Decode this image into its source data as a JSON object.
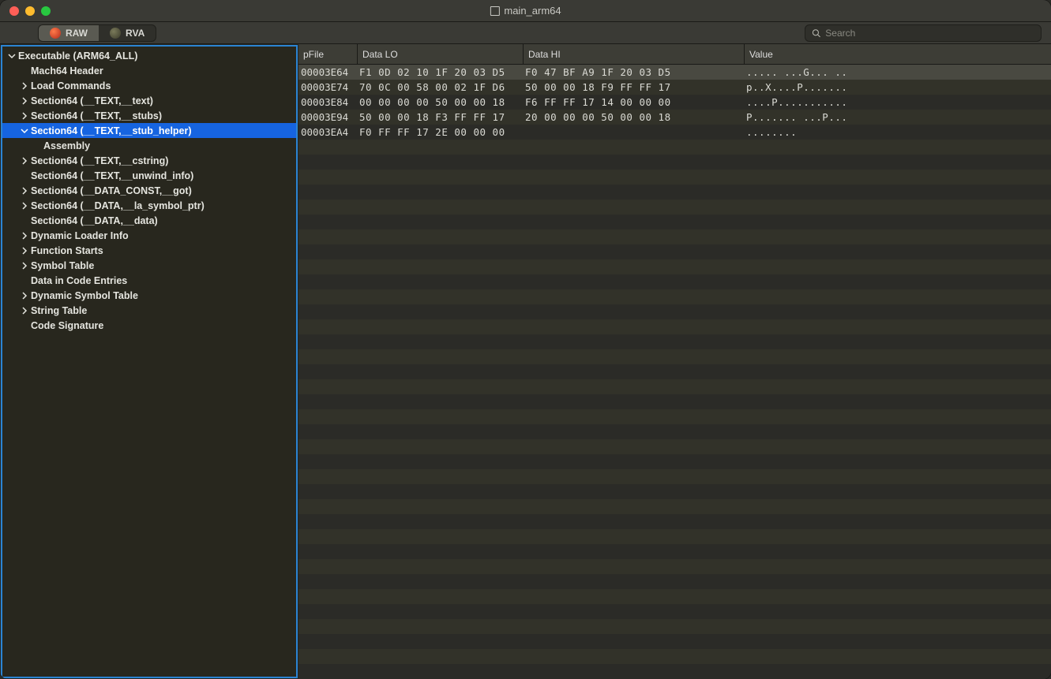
{
  "window": {
    "title": "main_arm64"
  },
  "toolbar": {
    "modes": [
      {
        "label": "RAW",
        "active": true
      },
      {
        "label": "RVA",
        "active": false
      }
    ],
    "search_placeholder": "Search"
  },
  "sidebar": {
    "items": [
      {
        "label": "Executable  (ARM64_ALL)",
        "depth": 0,
        "disclosure": "open"
      },
      {
        "label": "Mach64 Header",
        "depth": 1,
        "disclosure": "none"
      },
      {
        "label": "Load Commands",
        "depth": 1,
        "disclosure": "closed"
      },
      {
        "label": "Section64 (__TEXT,__text)",
        "depth": 1,
        "disclosure": "closed"
      },
      {
        "label": "Section64 (__TEXT,__stubs)",
        "depth": 1,
        "disclosure": "closed"
      },
      {
        "label": "Section64 (__TEXT,__stub_helper)",
        "depth": 1,
        "disclosure": "open",
        "selected": true
      },
      {
        "label": "Assembly",
        "depth": 2,
        "disclosure": "none"
      },
      {
        "label": "Section64 (__TEXT,__cstring)",
        "depth": 1,
        "disclosure": "closed"
      },
      {
        "label": "Section64 (__TEXT,__unwind_info)",
        "depth": 1,
        "disclosure": "none"
      },
      {
        "label": "Section64 (__DATA_CONST,__got)",
        "depth": 1,
        "disclosure": "closed"
      },
      {
        "label": "Section64 (__DATA,__la_symbol_ptr)",
        "depth": 1,
        "disclosure": "closed"
      },
      {
        "label": "Section64 (__DATA,__data)",
        "depth": 1,
        "disclosure": "none"
      },
      {
        "label": "Dynamic Loader Info",
        "depth": 1,
        "disclosure": "closed"
      },
      {
        "label": "Function Starts",
        "depth": 1,
        "disclosure": "closed"
      },
      {
        "label": "Symbol Table",
        "depth": 1,
        "disclosure": "closed"
      },
      {
        "label": "Data in Code Entries",
        "depth": 1,
        "disclosure": "none"
      },
      {
        "label": "Dynamic Symbol Table",
        "depth": 1,
        "disclosure": "closed"
      },
      {
        "label": "String Table",
        "depth": 1,
        "disclosure": "closed"
      },
      {
        "label": "Code Signature",
        "depth": 1,
        "disclosure": "none"
      }
    ]
  },
  "hex": {
    "headers": {
      "pfile": "pFile",
      "lo": "Data LO",
      "hi": "Data HI",
      "val": "Value"
    },
    "rows": [
      {
        "pfile": "00003E64",
        "lo": "F1 0D 02 10 1F 20 03 D5",
        "hi": "F0 47 BF A9 1F 20 03 D5",
        "val": "..... ...G... ..",
        "selected": true
      },
      {
        "pfile": "00003E74",
        "lo": "70 0C 00 58 00 02 1F D6",
        "hi": "50 00 00 18 F9 FF FF 17",
        "val": "p..X....P......."
      },
      {
        "pfile": "00003E84",
        "lo": "00 00 00 00 50 00 00 18",
        "hi": "F6 FF FF 17 14 00 00 00",
        "val": "....P..........."
      },
      {
        "pfile": "00003E94",
        "lo": "50 00 00 18 F3 FF FF 17",
        "hi": "20 00 00 00 50 00 00 18",
        "val": "P....... ...P..."
      },
      {
        "pfile": "00003EA4",
        "lo": "F0 FF FF 17 2E 00 00 00",
        "hi": "",
        "val": "........"
      }
    ]
  }
}
